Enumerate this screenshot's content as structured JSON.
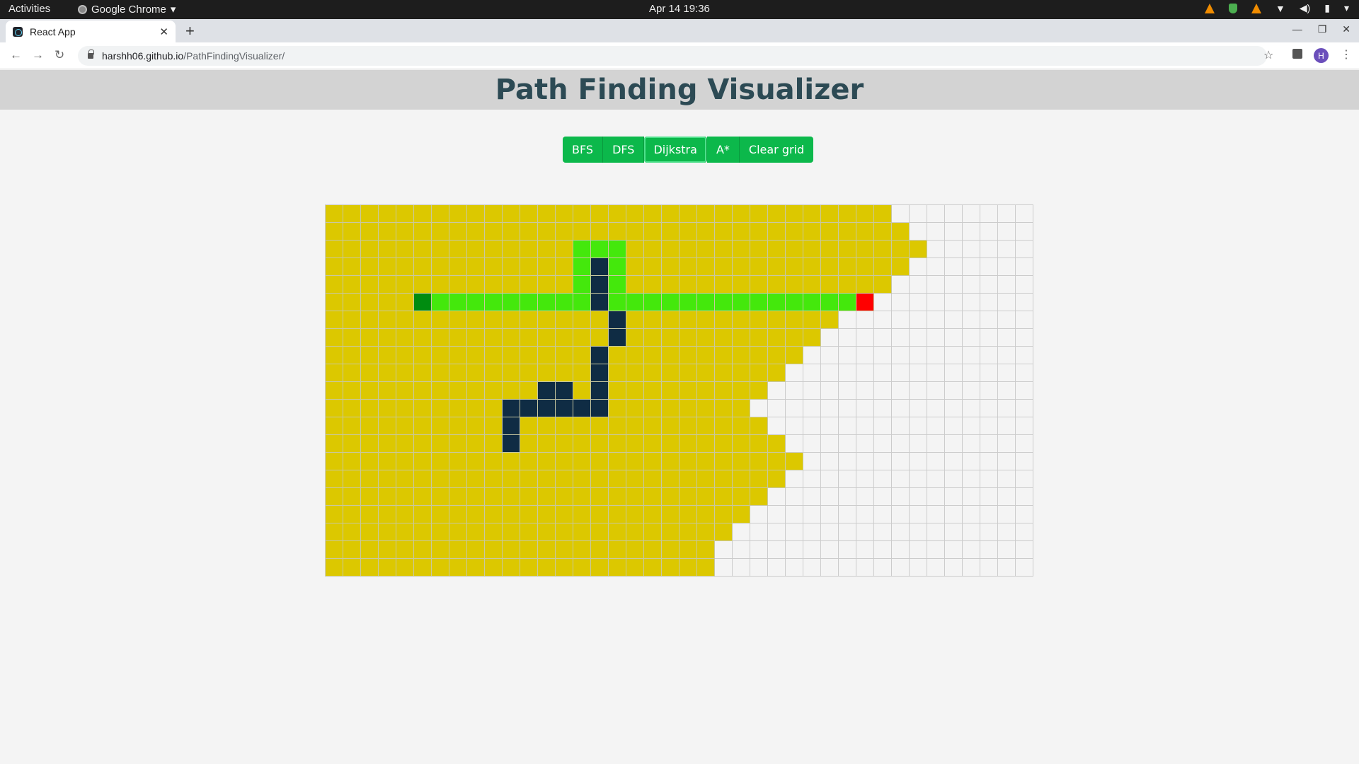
{
  "os": {
    "activities": "Activities",
    "app_name": "Google Chrome",
    "clock": "Apr 14  19:36"
  },
  "browser": {
    "tab_title": "React App",
    "url_host": "harshh06.github.io",
    "url_path": "/PathFindingVisualizer/",
    "avatar_letter": "H"
  },
  "app": {
    "title": "Path Finding Visualizer",
    "buttons": [
      {
        "label": "BFS"
      },
      {
        "label": "DFS"
      },
      {
        "label": "Dijkstra"
      },
      {
        "label": "A*"
      },
      {
        "label": "Clear grid"
      }
    ],
    "active_button": "Dijkstra"
  },
  "grid": {
    "rows": 21,
    "cols": 40,
    "legend": {
      "v": "visited",
      "p": "path",
      "w": "wall",
      "s": "start",
      "e": "end",
      ".": "empty"
    },
    "colors": {
      "visited": "#dcc800",
      "path": "#44e80c",
      "wall": "#0f2c44",
      "start": "#008c10",
      "end": "#ff0000",
      "empty": "#f4f4f4"
    },
    "cells": [
      "vvvvvvvvvvvvvvvvvvvvvvvvvvvvvvvv........",
      "vvvvvvvvvvvvvvvvvvvvvvvvvvvvvvvvv.......",
      "vvvvvvvvvvvvvvpppvvvvvvvvvvvvvvvvv......",
      "vvvvvvvvvvvvvvpwpvvvvvvvvvvvvvvvv.......",
      "vvvvvvvvvvvvvvpwpvvvvvvvvvvvvvvv........",
      "vvvvvspppppppppwppppppppppppppe.........",
      "vvvvvvvvvvvvvvvvwvvvvvvvvvvvv...........",
      "vvvvvvvvvvvvvvvvwvvvvvvvvvvv............",
      "vvvvvvvvvvvvvvvwvvvvvvvvvvv.............",
      "vvvvvvvvvvvvvvvwvvvvvvvvvv..............",
      "vvvvvvvvvvvvwwvwvvvvvvvvv...............",
      "vvvvvvvvvvwwwwwwvvvvvvvv................",
      "vvvvvvvvvvwvvvvvvvvvvvvvv...............",
      "vvvvvvvvvvwvvvvvvvvvvvvvvv..............",
      "vvvvvvvvvvvvvvvvvvvvvvvvvvv.............",
      "vvvvvvvvvvvvvvvvvvvvvvvvvv..............",
      "vvvvvvvvvvvvvvvvvvvvvvvvv...............",
      "vvvvvvvvvvvvvvvvvvvvvvvv................",
      "vvvvvvvvvvvvvvvvvvvvvvv.................",
      "vvvvvvvvvvvvvvvvvvvvvv..................",
      "vvvvvvvvvvvvvvvvvvvvvv.................."
    ]
  }
}
